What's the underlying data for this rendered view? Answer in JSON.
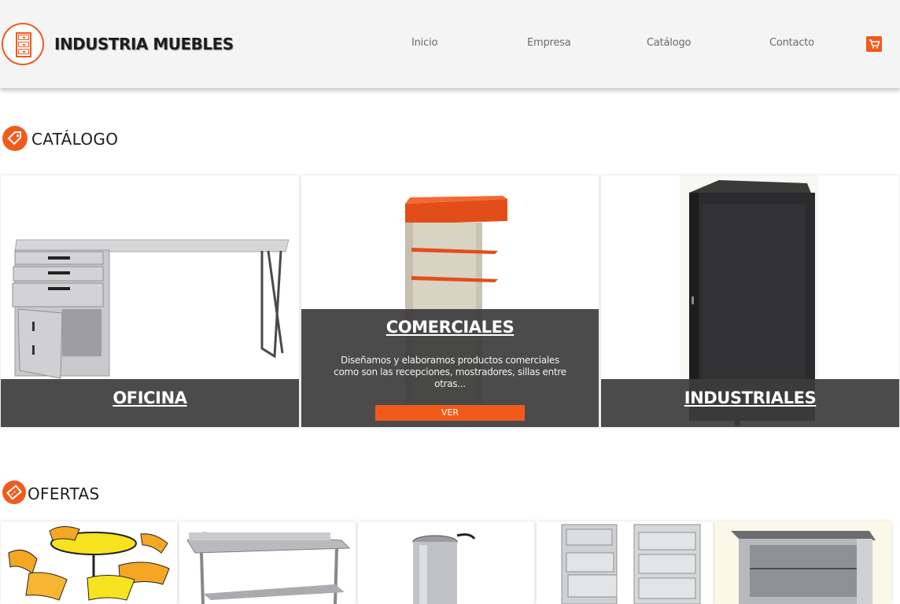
{
  "header": {
    "brand": "INDUSTRIA MUEBLES",
    "nav": [
      "Inicio",
      "Empresa",
      "Catálogo",
      "Contacto"
    ]
  },
  "catalog": {
    "title": "CATÁLOGO",
    "cards": [
      {
        "label": "OFICINA"
      },
      {
        "label": "COMERCIALES",
        "description": "Diseñamos y elaboramos productos comerciales como son las recepciones, mostradores, sillas entre otras...",
        "button": "VER"
      },
      {
        "label": "INDUSTRIALES"
      }
    ]
  },
  "offers": {
    "title": "OFERTAS"
  },
  "icons": {
    "logo": "cabinet-icon",
    "cart": "shopping-cart-icon",
    "catalog": "tag-icon",
    "offers": "ticket-icon"
  },
  "colors": {
    "accent": "#f25a1c",
    "header_bg": "#f4f4f4",
    "overlay": "#3c3c3c"
  }
}
